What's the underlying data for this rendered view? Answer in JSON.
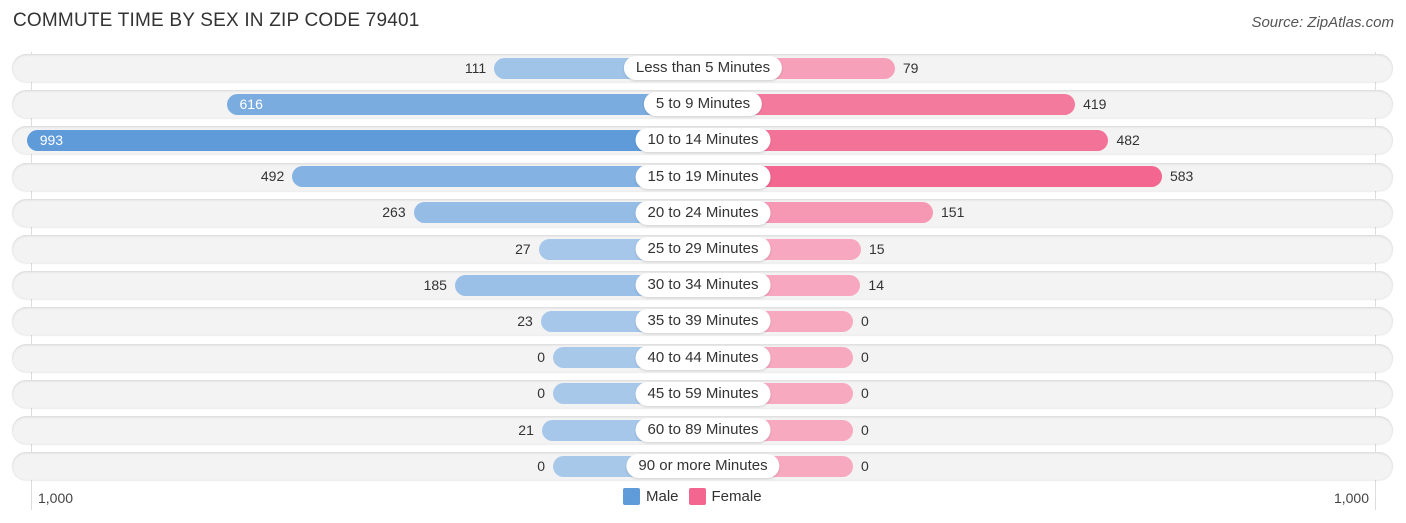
{
  "title": "COMMUTE TIME BY SEX IN ZIP CODE 79401",
  "source": "Source: ZipAtlas.com",
  "colors": {
    "male_strong": "#5f9bd9",
    "male_light": "#a8c8ea",
    "female_strong": "#f2668f",
    "female_light": "#f7a9c0"
  },
  "chart_data": {
    "type": "bar",
    "orientation": "horizontal-diverging",
    "title": "COMMUTE TIME BY SEX IN ZIP CODE 79401",
    "categories": [
      "Less than 5 Minutes",
      "5 to 9 Minutes",
      "10 to 14 Minutes",
      "15 to 19 Minutes",
      "20 to 24 Minutes",
      "25 to 29 Minutes",
      "30 to 34 Minutes",
      "35 to 39 Minutes",
      "40 to 44 Minutes",
      "45 to 59 Minutes",
      "60 to 89 Minutes",
      "90 or more Minutes"
    ],
    "series": [
      {
        "name": "Male",
        "values": [
          111,
          616,
          993,
          492,
          263,
          27,
          185,
          23,
          0,
          0,
          21,
          0
        ]
      },
      {
        "name": "Female",
        "values": [
          79,
          419,
          482,
          583,
          151,
          15,
          14,
          0,
          0,
          0,
          0,
          0
        ]
      }
    ],
    "axis_min_label": "1,000",
    "axis_max_label": "1,000",
    "xlim": [
      -1000,
      1000
    ],
    "legend": {
      "placement": "bottom-center",
      "entries": [
        "Male",
        "Female"
      ]
    }
  }
}
